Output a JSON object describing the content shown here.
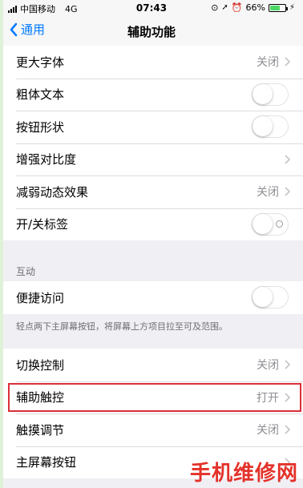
{
  "status_bar": {
    "carrier": "中国移动",
    "network": "4G",
    "time": "07:43",
    "battery_percent": "66%",
    "battery_level": 0.66
  },
  "nav": {
    "back_label": "通用",
    "title": "辅助功能"
  },
  "group1": [
    {
      "label": "更大字体",
      "value": "关闭",
      "type": "chevron"
    },
    {
      "label": "粗体文本",
      "type": "toggle",
      "on": false
    },
    {
      "label": "按钮形状",
      "type": "toggle",
      "on": false
    },
    {
      "label": "增强对比度",
      "type": "chevron"
    },
    {
      "label": "减弱动态效果",
      "value": "关闭",
      "type": "chevron"
    },
    {
      "label": "开/关标签",
      "type": "toggle",
      "on": false
    }
  ],
  "section2": {
    "header": "互动",
    "rows": [
      {
        "label": "便捷访问",
        "type": "toggle",
        "on": false
      }
    ],
    "footer": "轻点两下主屏幕按钮，将屏幕上方项目拉至可及范围。"
  },
  "group3": [
    {
      "label": "切换控制",
      "value": "关闭",
      "type": "chevron"
    },
    {
      "label": "辅助触控",
      "value": "打开",
      "type": "chevron"
    },
    {
      "label": "触摸调节",
      "value": "关闭",
      "type": "chevron"
    },
    {
      "label": "主屏幕按钮",
      "type": "chevron"
    }
  ],
  "watermark": "手机维修网",
  "colors": {
    "accent": "#007aff",
    "highlight_border": "#d9303a",
    "watermark": "#e3322a",
    "battery": "#4cd964"
  }
}
